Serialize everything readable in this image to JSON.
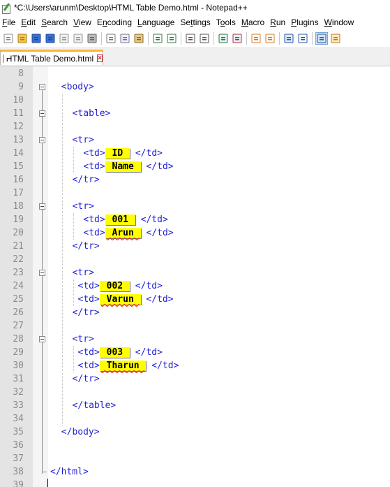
{
  "window": {
    "title": "*C:\\Users\\arunm\\Desktop\\HTML Table Demo.html - Notepad++"
  },
  "menu": [
    {
      "pre": "",
      "key": "F",
      "post": "ile"
    },
    {
      "pre": "",
      "key": "E",
      "post": "dit"
    },
    {
      "pre": "",
      "key": "S",
      "post": "earch"
    },
    {
      "pre": "",
      "key": "V",
      "post": "iew"
    },
    {
      "pre": "E",
      "key": "n",
      "post": "coding"
    },
    {
      "pre": "",
      "key": "L",
      "post": "anguage"
    },
    {
      "pre": "Se",
      "key": "t",
      "post": "tings"
    },
    {
      "pre": "T",
      "key": "o",
      "post": "ols"
    },
    {
      "pre": "",
      "key": "M",
      "post": "acro"
    },
    {
      "pre": "",
      "key": "R",
      "post": "un"
    },
    {
      "pre": "",
      "key": "P",
      "post": "lugins"
    },
    {
      "pre": "",
      "key": "W",
      "post": "indow"
    }
  ],
  "toolbar": {
    "buttons": [
      "new-file-icon",
      "open-file-icon",
      "save-icon",
      "save-all-icon",
      "close-icon",
      "close-all-icon",
      "print-icon",
      "cut-icon",
      "copy-icon",
      "paste-icon",
      "undo-icon",
      "redo-icon",
      "find-icon",
      "replace-icon",
      "zoom-in-icon",
      "zoom-out-icon",
      "sync-vertical-icon",
      "sync-horizontal-icon",
      "word-wrap-icon",
      "show-all-characters-icon",
      "indent-guide-icon",
      "user-defined-language-icon"
    ]
  },
  "tab": {
    "label": "HTML Table Demo.html"
  },
  "editor": {
    "lines": [
      {
        "n": "8",
        "indent": 0,
        "pre": "",
        "val": "",
        "post": ""
      },
      {
        "n": "9",
        "indent": 2,
        "fold": true,
        "pre": "<body>",
        "val": "",
        "post": ""
      },
      {
        "n": "10",
        "indent": 0,
        "pre": "",
        "val": "",
        "post": ""
      },
      {
        "n": "11",
        "indent": 4,
        "fold": true,
        "pre": "<table>",
        "val": "",
        "post": ""
      },
      {
        "n": "12",
        "indent": 0,
        "pre": "",
        "val": "",
        "post": ""
      },
      {
        "n": "13",
        "indent": 4,
        "fold": true,
        "pre": "<tr>",
        "val": "",
        "post": ""
      },
      {
        "n": "14",
        "indent": 6,
        "pre": "<td>",
        "val": " ID ",
        "post": " </td>"
      },
      {
        "n": "15",
        "indent": 6,
        "pre": "<td>",
        "val": " Name ",
        "post": " </td>"
      },
      {
        "n": "16",
        "indent": 4,
        "pre": "</tr>",
        "val": "",
        "post": ""
      },
      {
        "n": "17",
        "indent": 0,
        "pre": "",
        "val": "",
        "post": ""
      },
      {
        "n": "18",
        "indent": 4,
        "fold": true,
        "pre": "<tr>",
        "val": "",
        "post": ""
      },
      {
        "n": "19",
        "indent": 6,
        "pre": "<td>",
        "val": " 001 ",
        "post": " </td>"
      },
      {
        "n": "20",
        "indent": 6,
        "pre": "<td>",
        "val": " Arun ",
        "post": " </td>",
        "squiggle": true
      },
      {
        "n": "21",
        "indent": 4,
        "pre": "</tr>",
        "val": "",
        "post": ""
      },
      {
        "n": "22",
        "indent": 0,
        "pre": "",
        "val": "",
        "post": ""
      },
      {
        "n": "23",
        "indent": 4,
        "fold": true,
        "pre": "<tr>",
        "val": "",
        "post": ""
      },
      {
        "n": "24",
        "indent": 5,
        "pre": "<td>",
        "val": " 002 ",
        "post": " </td>"
      },
      {
        "n": "25",
        "indent": 5,
        "pre": "<td>",
        "val": " Varun ",
        "post": " </td>",
        "squiggle": true
      },
      {
        "n": "26",
        "indent": 4,
        "pre": "</tr>",
        "val": "",
        "post": ""
      },
      {
        "n": "27",
        "indent": 0,
        "pre": "",
        "val": "",
        "post": ""
      },
      {
        "n": "28",
        "indent": 4,
        "fold": true,
        "pre": "<tr>",
        "val": "",
        "post": ""
      },
      {
        "n": "29",
        "indent": 5,
        "pre": "<td>",
        "val": " 003 ",
        "post": " </td>"
      },
      {
        "n": "30",
        "indent": 5,
        "pre": "<td>",
        "val": " Tharun ",
        "post": " </td>",
        "squiggle": true
      },
      {
        "n": "31",
        "indent": 4,
        "pre": "</tr>",
        "val": "",
        "post": ""
      },
      {
        "n": "32",
        "indent": 0,
        "pre": "",
        "val": "",
        "post": ""
      },
      {
        "n": "33",
        "indent": 4,
        "pre": "</table>",
        "val": "",
        "post": ""
      },
      {
        "n": "34",
        "indent": 0,
        "pre": "",
        "val": "",
        "post": ""
      },
      {
        "n": "35",
        "indent": 2,
        "pre": "</body>",
        "val": "",
        "post": ""
      },
      {
        "n": "36",
        "indent": 0,
        "pre": "",
        "val": "",
        "post": ""
      },
      {
        "n": "37",
        "indent": 0,
        "pre": "",
        "val": "",
        "post": ""
      },
      {
        "n": "38",
        "indent": 0,
        "pre": "</html>",
        "val": "",
        "post": ""
      },
      {
        "n": "39",
        "indent": 0,
        "pre": "",
        "val": "",
        "post": ""
      }
    ]
  },
  "colors": {
    "tag": "#1f1fd6",
    "highlight": "#ffff00",
    "gutter": "#e4e4e4",
    "tab_accent": "#f7b73a"
  }
}
